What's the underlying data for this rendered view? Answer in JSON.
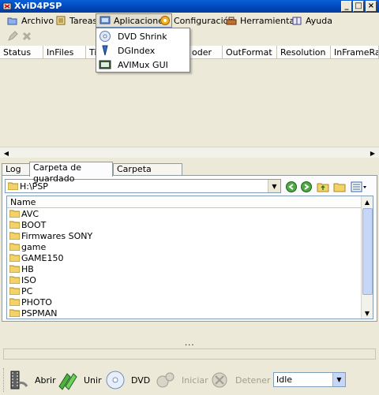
{
  "window": {
    "title": "XviD4PSP"
  },
  "menu": {
    "items": [
      {
        "label": "Archivo"
      },
      {
        "label": "Tareas"
      },
      {
        "label": "Aplicaciones"
      },
      {
        "label": "Configuración"
      },
      {
        "label": "Herramientas"
      },
      {
        "label": "Ayuda"
      }
    ],
    "open_menu": "Aplicaciones",
    "dropdown": [
      {
        "label": "DVD Shrink"
      },
      {
        "label": "DGIndex"
      },
      {
        "label": "AVIMux GUI"
      }
    ]
  },
  "tasklist": {
    "columns": [
      "Status",
      "InFiles",
      "Ti",
      "oder",
      "OutFormat",
      "Resolution",
      "InFrameRate"
    ]
  },
  "tabs": [
    {
      "label": "Log"
    },
    {
      "label": "Carpeta de guardado"
    },
    {
      "label": "Carpeta temporal"
    }
  ],
  "active_tab": "Carpeta de guardado",
  "path": {
    "value": "H:\\PSP"
  },
  "filelist": {
    "header": "Name",
    "items": [
      "AVC",
      "BOOT",
      "Firmwares SONY",
      "game",
      "GAME150",
      "HB",
      "ISO",
      "PC",
      "PHOTO",
      "PSPMAN"
    ]
  },
  "status": {
    "dots": "..."
  },
  "bottombar": {
    "open_label": "Abrir",
    "join_label": "Unir",
    "dvd_label": "DVD",
    "start_label": "Iniciar",
    "stop_label": "Detener",
    "state_value": "Idle"
  }
}
